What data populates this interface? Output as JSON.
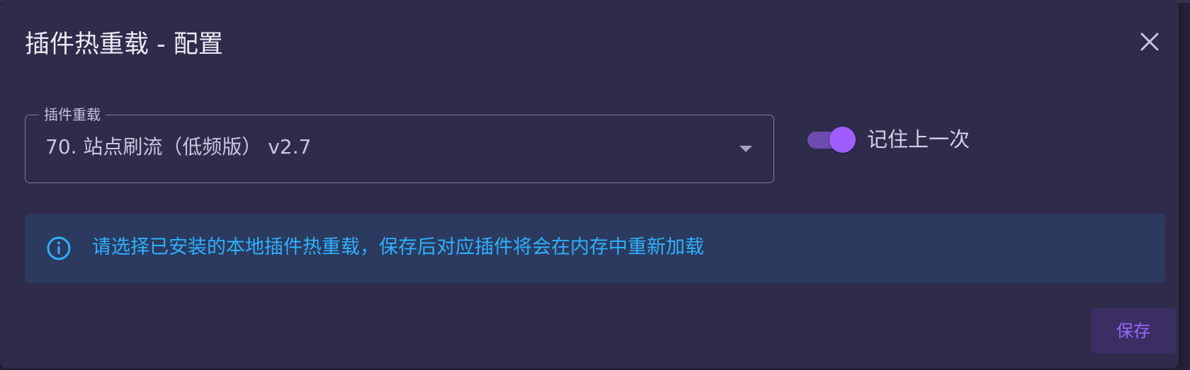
{
  "dialog": {
    "title": "插件热重载 - 配置",
    "close_icon": "close-icon"
  },
  "plugin_select": {
    "label": "插件重载",
    "value": "70. 站点刷流（低频版） v2.7",
    "arrow_icon": "caret-down-icon"
  },
  "remember_toggle": {
    "label": "记住上一次",
    "checked": true
  },
  "alert": {
    "icon": "info-icon",
    "text": "请选择已安装的本地插件热重载，保存后对应插件将会在内存中重新加载"
  },
  "actions": {
    "save_label": "保存"
  },
  "colors": {
    "dialog_bg": "#2f2b4b",
    "accent": "#9f5cff",
    "info_text": "#2db1ff",
    "info_bg": "#2b3a5e"
  }
}
